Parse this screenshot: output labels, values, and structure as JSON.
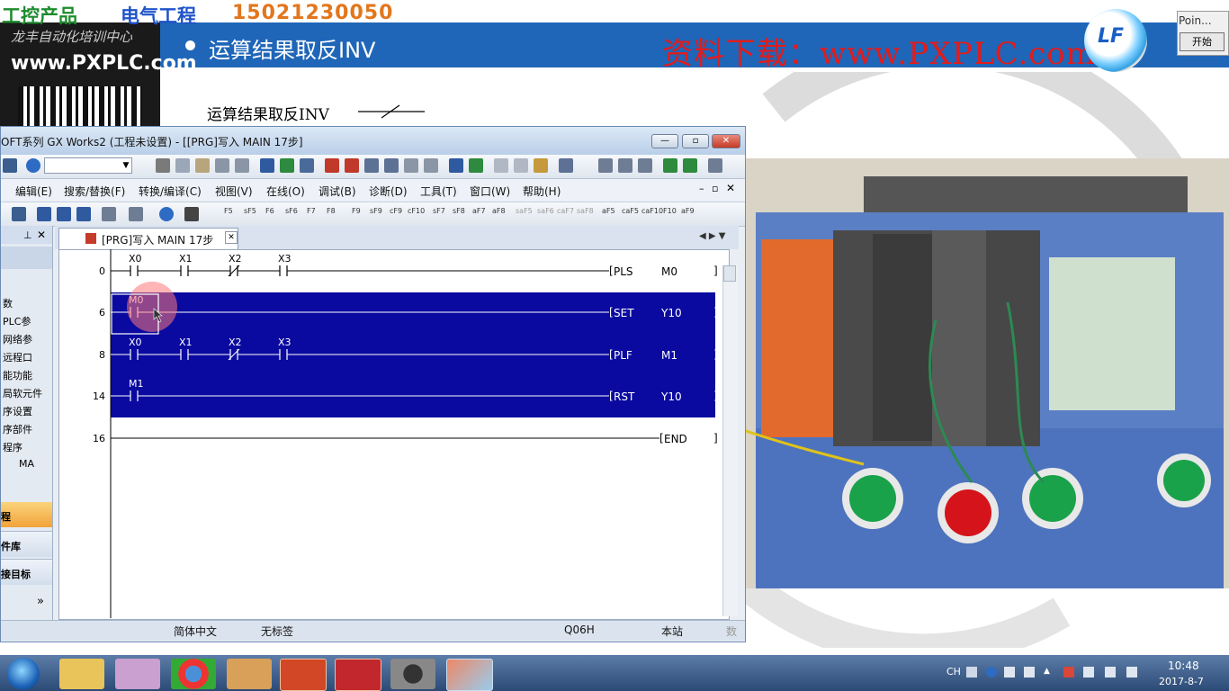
{
  "overlay": {
    "product": "工控产品",
    "electric": "电气工程",
    "phone": "15021230050",
    "left_strip_line1": "龙丰自动化培训中心",
    "left_strip_line2": "www.PXPLC.com",
    "lf_logo": "LF"
  },
  "slide": {
    "heading": "运算结果取反INV",
    "download": "资料下载：www.PXPLC.com",
    "inv_label": "运算结果取反INV"
  },
  "pointer_popup": {
    "title": "Poin...",
    "start_button": "开始"
  },
  "window": {
    "title": "OFT系列 GX Works2 (工程未设置) - [[PRG]写入 MAIN 17步]",
    "min": "▭",
    "max": "▭",
    "close": "✕"
  },
  "menus": [
    "编辑(E)",
    "搜索/替换(F)",
    "转换/编译(C)",
    "视图(V)",
    "在线(O)",
    "调试(B)",
    "诊断(D)",
    "工具(T)",
    "窗口(W)",
    "帮助(H)"
  ],
  "function_keys": [
    "F5",
    "sF5",
    "F6",
    "sF6",
    "F7",
    "F8",
    "F9",
    "sF9",
    "cF9",
    "cF10",
    "sF7",
    "sF8",
    "aF7",
    "aF8",
    "saF5",
    "saF6",
    "caF7",
    "saF8",
    "aF5",
    "caF5",
    "caF10",
    "F10",
    "aF9"
  ],
  "nav": {
    "items": [
      "数",
      "PLC参",
      "网络参",
      "远程口",
      "能功能",
      "局软元件",
      "序设置",
      "序部件",
      "程序",
      "MA"
    ],
    "bottom": [
      "程",
      "件库",
      "接目标"
    ],
    "more": "»"
  },
  "tab": {
    "label": "[PRG]写入 MAIN 17步"
  },
  "ladder": {
    "rungs": [
      {
        "step": "0",
        "contacts": [
          "X0",
          "X1",
          "X2",
          "X3"
        ],
        "contact_types": [
          "no",
          "no",
          "nc",
          "no"
        ],
        "instruction": "PLS",
        "operand": "M0",
        "selected": false
      },
      {
        "step": "6",
        "contacts": [
          "M0"
        ],
        "contact_types": [
          "no"
        ],
        "instruction": "SET",
        "operand": "Y10",
        "selected": true
      },
      {
        "step": "8",
        "contacts": [
          "X0",
          "X1",
          "X2",
          "X3"
        ],
        "contact_types": [
          "no",
          "no",
          "nc",
          "no"
        ],
        "instruction": "PLF",
        "operand": "M1",
        "selected": true
      },
      {
        "step": "14",
        "contacts": [
          "M1"
        ],
        "contact_types": [
          "no"
        ],
        "instruction": "RST",
        "operand": "Y10",
        "selected": true
      },
      {
        "step": "16",
        "contacts": [],
        "contact_types": [],
        "instruction": "END",
        "operand": "",
        "selected": false
      }
    ],
    "selection_color": "#0a0aa0"
  },
  "statusbar": {
    "language": "简体中文",
    "label": "无标签",
    "cpu": "Q06H",
    "station": "本站",
    "extra": "数"
  },
  "taskbar": {
    "time": "10:48",
    "date": "2017-8-7",
    "ime": "CH"
  },
  "colors": {
    "slide_band": "#1f66b8",
    "download_red": "#e21b1b",
    "selection": "#0a0aa0"
  }
}
